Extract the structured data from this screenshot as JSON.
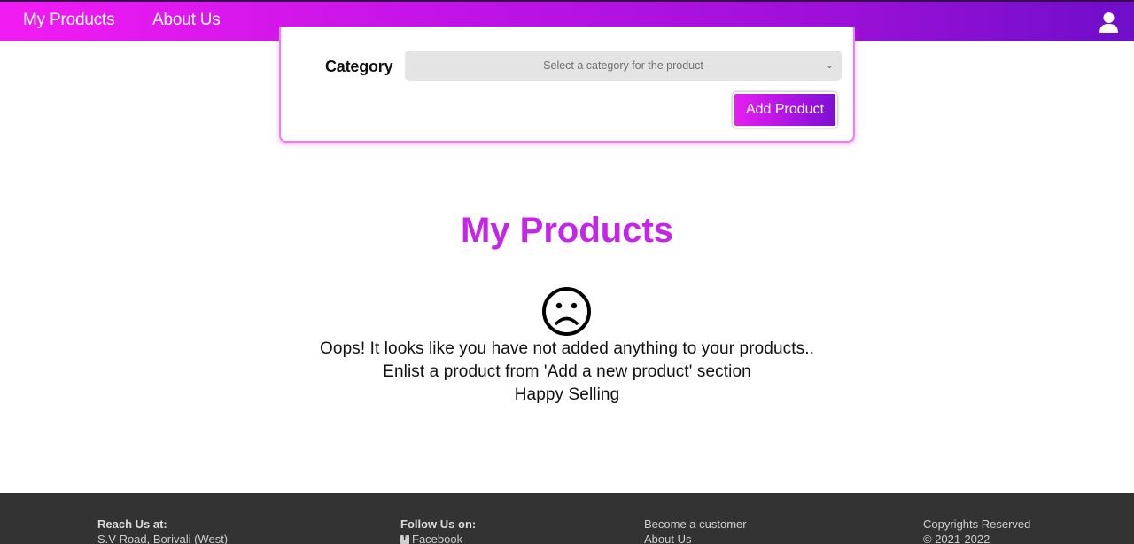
{
  "navbar": {
    "links": [
      "My Products",
      "About Us"
    ],
    "user_icon": "user-icon"
  },
  "form": {
    "category_label": "Category",
    "category_placeholder": "Select a category for the product",
    "add_button": "Add Product"
  },
  "main": {
    "title": "My Products",
    "empty_icon": "sad-face-icon",
    "message_lines": [
      "Oops! It looks like you have not added anything to your products..",
      "Enlist a product from 'Add a new product' section",
      "Happy Selling"
    ]
  },
  "footer": {
    "reach": {
      "heading": "Reach Us at:",
      "address": "S.V Road, Borivali (West)"
    },
    "follow": {
      "heading": "Follow Us on:",
      "facebook": "Facebook",
      "icon": "facebook-icon"
    },
    "links": [
      "Become a customer",
      "About Us"
    ],
    "copyright": {
      "line1": "Copyrights Reserved",
      "line2": "© 2021-2022"
    }
  },
  "colors": {
    "nav_gradient_start": "#f21cf3",
    "nav_gradient_end": "#6f0ec9",
    "title": "#c425e6",
    "footer_bg": "#333333"
  }
}
